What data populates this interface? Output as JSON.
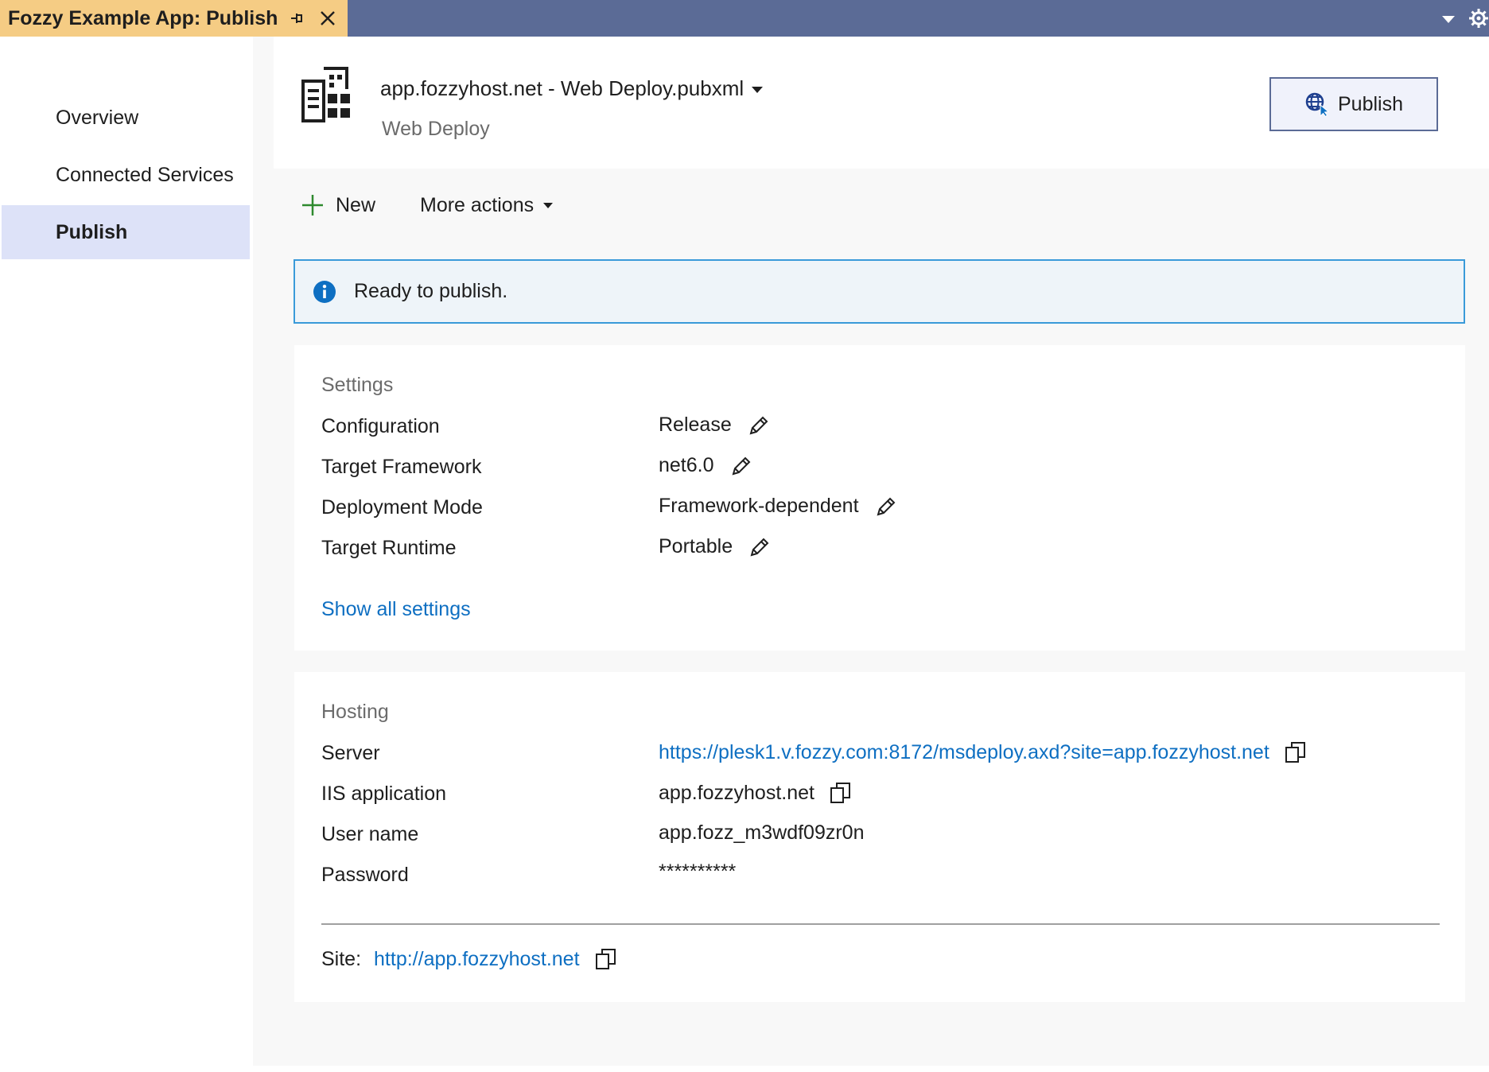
{
  "window": {
    "tab_title": "Fozzy Example App: Publish",
    "pin_icon": "pin-icon",
    "close_icon": "close-icon",
    "menu_icon": "chevron-down-icon",
    "settings_icon": "gear-icon"
  },
  "sidebar": {
    "items": [
      {
        "label": "Overview",
        "active": false
      },
      {
        "label": "Connected Services",
        "active": false
      },
      {
        "label": "Publish",
        "active": true
      }
    ]
  },
  "header": {
    "profile_name": "app.fozzyhost.net - Web Deploy.pubxml",
    "profile_type": "Web Deploy",
    "publish_label": "Publish"
  },
  "toolbar": {
    "new_label": "New",
    "more_actions_label": "More actions"
  },
  "banner": {
    "message": "Ready to publish."
  },
  "settings": {
    "title": "Settings",
    "rows": [
      {
        "label": "Configuration",
        "value": "Release"
      },
      {
        "label": "Target Framework",
        "value": "net6.0"
      },
      {
        "label": "Deployment Mode",
        "value": "Framework-dependent"
      },
      {
        "label": "Target Runtime",
        "value": "Portable"
      }
    ],
    "show_all_label": "Show all settings"
  },
  "hosting": {
    "title": "Hosting",
    "rows": [
      {
        "label": "Server",
        "value": "https://plesk1.v.fozzy.com:8172/msdeploy.axd?site=app.fozzyhost.net"
      },
      {
        "label": "IIS application",
        "value": "app.fozzyhost.net"
      },
      {
        "label": "User name",
        "value": "app.fozz_m3wdf09zr0n"
      },
      {
        "label": "Password",
        "value": "**********"
      }
    ],
    "site_label": "Site:",
    "site_url": "http://app.fozzyhost.net"
  },
  "colors": {
    "tab_accent": "#f5cc84",
    "titlebar": "#5b6b96",
    "active_nav": "#dde2f8",
    "link": "#0e6fc2",
    "info_border": "#3a9ad9"
  }
}
